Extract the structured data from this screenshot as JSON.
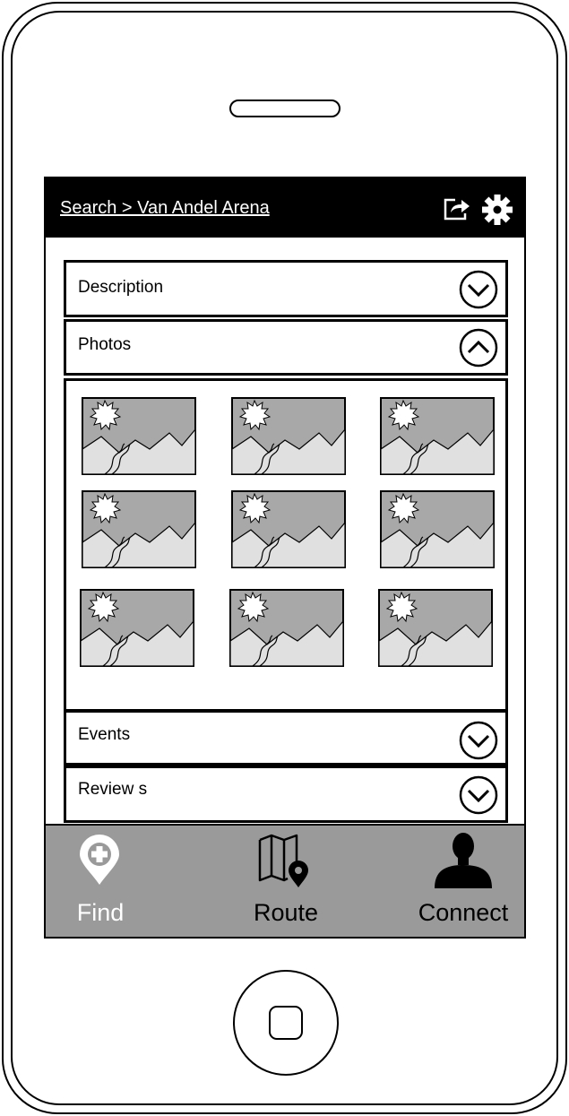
{
  "header": {
    "breadcrumb": "Search > Van Andel Arena",
    "share_icon": "share-icon",
    "settings_icon": "gear-icon"
  },
  "sections": {
    "description": {
      "label": "Description",
      "state": "collapsed"
    },
    "photos": {
      "label": "Photos",
      "state": "expanded"
    },
    "events": {
      "label": "Events",
      "state": "collapsed"
    },
    "reviews": {
      "label": "Review s",
      "state": "collapsed"
    }
  },
  "photos": {
    "count": 9,
    "icon": "image-placeholder-icon"
  },
  "tabs": {
    "find": {
      "label": "Find",
      "icon": "map-pin-plus-icon",
      "active": true
    },
    "route": {
      "label": "Route",
      "icon": "map-route-icon"
    },
    "connect": {
      "label": "Connect",
      "icon": "person-icon"
    }
  },
  "colors": {
    "topbar": "#000000",
    "tabbar": "#9a9a9a",
    "active_tab": "#ffffff",
    "photo_sky": "#a8a8a8",
    "photo_mountain": "#e0e0e0"
  }
}
